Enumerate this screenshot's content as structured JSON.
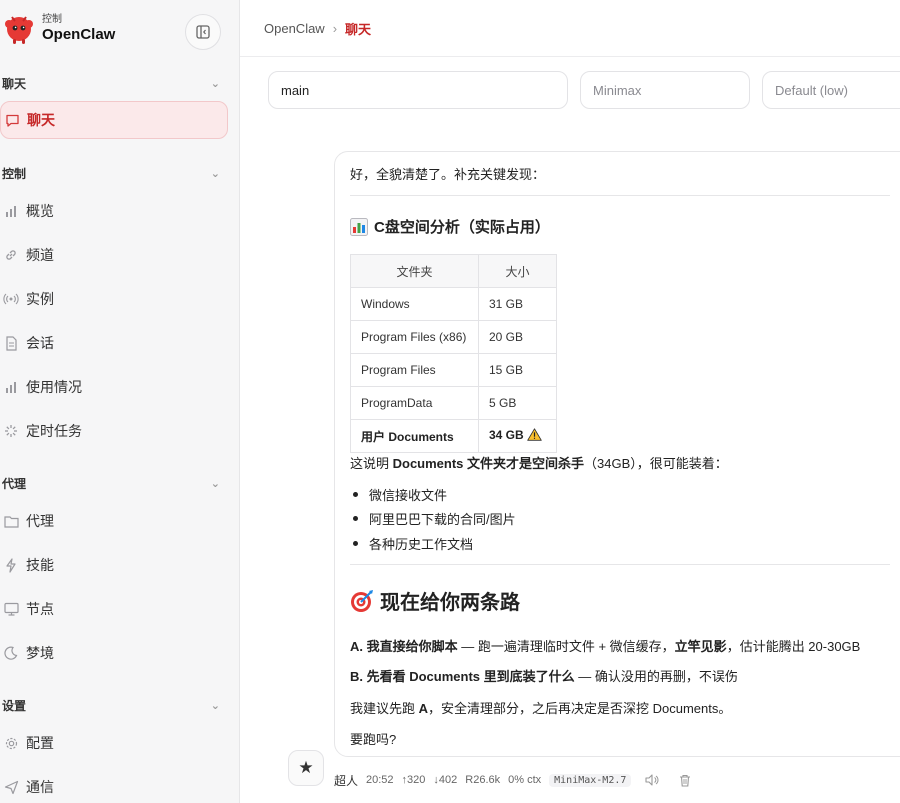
{
  "brand": {
    "small_label": "控制",
    "name": "OpenClaw"
  },
  "sidebar": {
    "groups": [
      {
        "title": "聊天",
        "items": [
          {
            "label": "聊天",
            "icon": "chat-bubble-icon",
            "active": true
          }
        ]
      },
      {
        "title": "控制",
        "items": [
          {
            "label": "概览",
            "icon": "bar-chart-icon"
          },
          {
            "label": "频道",
            "icon": "link-icon"
          },
          {
            "label": "实例",
            "icon": "radio-waves-icon"
          },
          {
            "label": "会话",
            "icon": "document-icon"
          },
          {
            "label": "使用情况",
            "icon": "bar-chart-icon"
          },
          {
            "label": "定时任务",
            "icon": "loading-spinner-icon"
          }
        ]
      },
      {
        "title": "代理",
        "items": [
          {
            "label": "代理",
            "icon": "folder-icon"
          },
          {
            "label": "技能",
            "icon": "lightning-icon"
          },
          {
            "label": "节点",
            "icon": "monitor-icon"
          },
          {
            "label": "梦境",
            "icon": "moon-icon"
          }
        ]
      },
      {
        "title": "设置",
        "items": [
          {
            "label": "配置",
            "icon": "gear-icon"
          },
          {
            "label": "通信",
            "icon": "send-icon"
          }
        ]
      }
    ]
  },
  "breadcrumb": {
    "root": "OpenClaw",
    "separator": "›",
    "current": "聊天"
  },
  "selectors": {
    "session": "main",
    "model": "Minimax",
    "thinking": "Default (low)"
  },
  "message": {
    "intro": "好，全貌清楚了。补充关键发现：",
    "section1_title": "C盘空间分析（实际占用）",
    "table": {
      "headers": [
        "文件夹",
        "大小"
      ],
      "rows": [
        [
          "Windows",
          "31 GB"
        ],
        [
          "Program Files (x86)",
          "20 GB"
        ],
        [
          "Program Files",
          "15 GB"
        ],
        [
          "ProgramData",
          "5 GB"
        ],
        [
          "用户 Documents",
          "34 GB"
        ]
      ]
    },
    "explain": {
      "prefix": "这说明 ",
      "bold": "Documents 文件夹才是空间杀手",
      "suffix": "（34GB），很可能装着："
    },
    "bullets": [
      "微信接收文件",
      "阿里巴巴下载的合同/图片",
      "各种历史工作文档"
    ],
    "section2_title": "现在给你两条路",
    "option_a": {
      "bold": "A. 我直接给你脚本",
      "mid": " — 跑一遍清理临时文件 + 微信缓存，",
      "bold2": "立竿见影",
      "end": "，估计能腾出 20-30GB"
    },
    "option_b": {
      "bold": "B. 先看看 Documents 里到底装了什么",
      "end": " — 确认没用的再删，不误伤"
    },
    "suggest": {
      "prefix": "我建议先跑 ",
      "bold": "A",
      "suffix": "，安全清理部分，之后再决定是否深挖 Documents。"
    },
    "question": "要跑吗?"
  },
  "meta": {
    "sender": "超人",
    "time": "20:52",
    "tokens_up": "↑320",
    "tokens_down": "↓402",
    "read": "R26.6k",
    "ctx": "0% ctx",
    "model": "MiniMax-M2.7"
  },
  "colors": {
    "accent": "#c62828",
    "active_bg": "#fbe9ea"
  }
}
